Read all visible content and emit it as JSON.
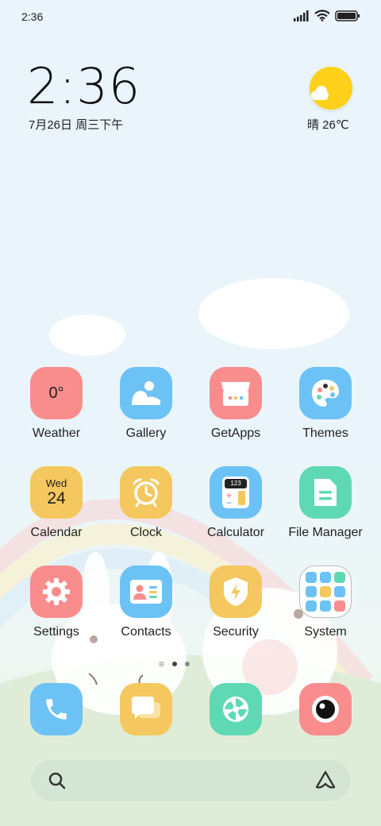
{
  "status_bar": {
    "time": "2:36",
    "icons": [
      "signal-icon",
      "wifi-icon",
      "battery-icon"
    ]
  },
  "clock_widget": {
    "time": "2:36",
    "date": "7月26日 周三下午"
  },
  "weather_widget": {
    "text": "晴 26℃",
    "icon": "sun-cloud-icon"
  },
  "apps": [
    {
      "label": "Weather",
      "icon": "weather-icon",
      "color": "#f98d8d",
      "text": "0°"
    },
    {
      "label": "Gallery",
      "icon": "gallery-icon",
      "color": "#6cc2f5"
    },
    {
      "label": "GetApps",
      "icon": "store-icon",
      "color": "#f98d8d"
    },
    {
      "label": "Themes",
      "icon": "palette-icon",
      "color": "#6cc2f5"
    },
    {
      "label": "Calendar",
      "icon": "calendar-icon",
      "color": "#f4c85e",
      "day": "Wed",
      "date": "24"
    },
    {
      "label": "Clock",
      "icon": "alarm-clock-icon",
      "color": "#f4c85e"
    },
    {
      "label": "Calculator",
      "icon": "calculator-icon",
      "color": "#6cc2f5",
      "display": "123"
    },
    {
      "label": "File Manager",
      "icon": "file-icon",
      "color": "#5fd9b4"
    },
    {
      "label": "Settings",
      "icon": "gear-icon",
      "color": "#f98d8d"
    },
    {
      "label": "Contacts",
      "icon": "contact-card-icon",
      "color": "#6cc2f5"
    },
    {
      "label": "Security",
      "icon": "shield-icon",
      "color": "#f4c85e"
    },
    {
      "label": "System",
      "icon": "folder-icon",
      "color": "#ffffff"
    }
  ],
  "dock": [
    {
      "name": "phone",
      "icon": "phone-icon",
      "color": "#6cc2f5"
    },
    {
      "name": "messages",
      "icon": "chat-icon",
      "color": "#f4c85e"
    },
    {
      "name": "browser",
      "icon": "aperture-icon",
      "color": "#5fd9b4"
    },
    {
      "name": "camera",
      "icon": "camera-icon",
      "color": "#f98d8d"
    }
  ],
  "page_indicator": {
    "pages": 2,
    "current": 1
  },
  "search_bar": {
    "left_icon": "search-icon",
    "right_icon": "assistant-icon"
  }
}
